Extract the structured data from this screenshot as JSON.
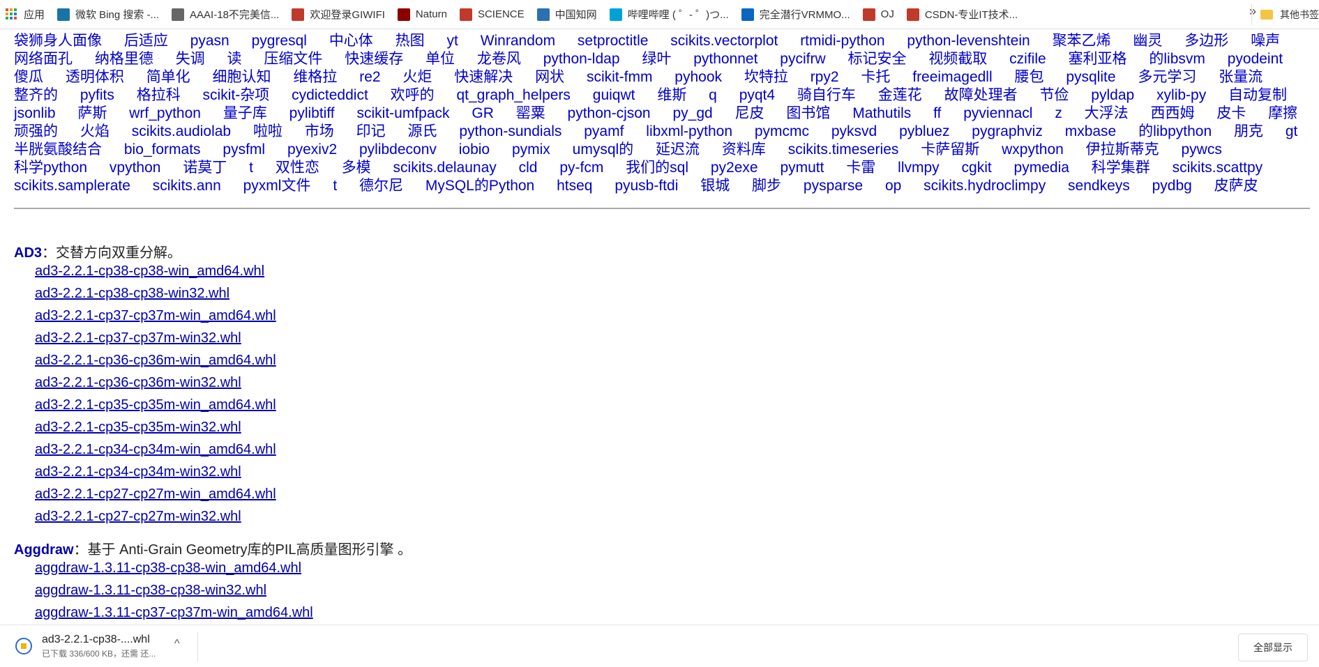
{
  "bookmarks": [
    {
      "label": "应用",
      "icon": "apps-grid-icon"
    },
    {
      "label": "微软 Bing 搜索 -...",
      "icon": "bing-icon"
    },
    {
      "label": "AAAI-18不完美信...",
      "icon": "globe-icon"
    },
    {
      "label": "欢迎登录GIWIFI",
      "icon": "giwifi-icon"
    },
    {
      "label": "Naturn",
      "icon": "nature-icon"
    },
    {
      "label": "SCIENCE",
      "icon": "science-icon"
    },
    {
      "label": "中国知网",
      "icon": "cnki-icon"
    },
    {
      "label": "哔哩哔哩 ( ゜- ゜)つ...",
      "icon": "bilibili-icon"
    },
    {
      "label": "完全潜行VRMMO...",
      "icon": "zhihu-icon"
    },
    {
      "label": "OJ",
      "icon": "oj-icon"
    },
    {
      "label": "CSDN-专业IT技术...",
      "icon": "csdn-icon"
    }
  ],
  "bookmarks_more": "»",
  "bookmarks_other": "其他书签",
  "package_cloud": [
    "袋狮身人面像",
    "后适应",
    "pyasn",
    "pygresql",
    "中心体",
    "热图",
    "yt",
    "Winrandom",
    "setproctitle",
    "scikits.vectorplot",
    "rtmidi-python",
    "python-levenshtein",
    "聚苯乙烯",
    "幽灵",
    "多边形",
    "噪声",
    "网络面孔",
    "纳格里德",
    "失调",
    "读",
    "压缩文件",
    "快速缓存",
    "单位",
    "龙卷风",
    "python-ldap",
    "绿叶",
    "pythonnet",
    "pycifrw",
    "标记安全",
    "视频截取",
    "czifile",
    "塞利亚格",
    "的libsvm",
    "pyodeint",
    "傻瓜",
    "透明体积",
    "简单化",
    "细胞认知",
    "维格拉",
    "re2",
    "火炬",
    "快速解决",
    "网状",
    "scikit-fmm",
    "pyhook",
    "坎特拉",
    "rpy2",
    "卡托",
    "freeimagedll",
    "腰包",
    "pysqlite",
    "多元学习",
    "张量流",
    "整齐的",
    "pyfits",
    "格拉科",
    "scikit-杂项",
    "cydicteddict",
    "欢呼的",
    "qt_graph_helpers",
    "guiqwt",
    "维斯",
    "q",
    "pyqt4",
    "骑自行车",
    "金莲花",
    "故障处理者",
    "节俭",
    "pyldap",
    "xylib-py",
    "自动复制",
    "jsonlib",
    "萨斯",
    "wrf_python",
    "量子库",
    "pylibtiff",
    "scikit-umfpack",
    "GR",
    "罂粟",
    "python-cjson",
    "py_gd",
    "尼皮",
    "图书馆",
    "Mathutils",
    "ff",
    "pyviennacl",
    "z",
    "大浮法",
    "西西姆",
    "皮卡",
    "摩擦",
    "顽强的",
    "火焰",
    "scikits.audiolab",
    "啦啦",
    "市场",
    "印记",
    "源氏",
    "python-sundials",
    "pyamf",
    "libxml-python",
    "pymcmc",
    "pyksvd",
    "pybluez",
    "pygraphviz",
    "mxbase",
    "的libpython",
    "朋克",
    "gt",
    "半胱氨酸结合",
    "bio_formats",
    "pysfml",
    "pyexiv2",
    "pylibdeconv",
    "iobio",
    "pymix",
    "umysql的",
    "延迟流",
    "资料库",
    "scikits.timeseries",
    "卡萨留斯",
    "wxpython",
    "伊拉斯蒂克",
    "pywcs",
    "科学python",
    "vpython",
    "诺莫丁",
    "t",
    "双性恋",
    "多模",
    "scikits.delaunay",
    "cld",
    "py-fcm",
    "我们的sql",
    "py2exe",
    "pymutt",
    "卡雷",
    "llvmpy",
    "cgkit",
    "pymedia",
    "科学集群",
    "scikits.scattpy",
    "scikits.samplerate",
    "scikits.ann",
    "pyxml文件",
    "t",
    "德尔尼",
    "MySQL的Python",
    "htseq",
    "pyusb-ftdi",
    "银城",
    "脚步",
    "pysparse",
    "op",
    "scikits.hydroclimpy",
    "sendkeys",
    "pydbg",
    "皮萨皮"
  ],
  "packages": [
    {
      "name": "AD3",
      "description": "：交替方向双重分解。",
      "files": [
        "ad3-2.2.1-cp38-cp38-win_amd64.whl",
        "ad3-2.2.1-cp38-cp38-win32.whl",
        "ad3-2.2.1-cp37-cp37m-win_amd64.whl",
        "ad3-2.2.1-cp37-cp37m-win32.whl",
        "ad3-2.2.1-cp36-cp36m-win_amd64.whl",
        "ad3-2.2.1-cp36-cp36m-win32.whl",
        "ad3-2.2.1-cp35-cp35m-win_amd64.whl",
        "ad3-2.2.1-cp35-cp35m-win32.whl",
        "ad3-2.2.1-cp34-cp34m-win_amd64.whl",
        "ad3-2.2.1-cp34-cp34m-win32.whl",
        "ad3-2.2.1-cp27-cp27m-win_amd64.whl",
        "ad3-2.2.1-cp27-cp27m-win32.whl"
      ]
    },
    {
      "name": "Aggdraw",
      "description": "：基于 Anti-Grain Geometry库的PIL高质量图形引擎 。",
      "files": [
        "aggdraw-1.3.11-cp38-cp38-win_amd64.whl",
        "aggdraw-1.3.11-cp38-cp38-win32.whl",
        "aggdraw-1.3.11-cp37-cp37m-win_amd64.whl"
      ]
    }
  ],
  "download": {
    "filename": "ad3-2.2.1-cp38-....whl",
    "status": "已下载 336/600 KB，还需 还...",
    "chevron": "^",
    "show_all": "全部显示"
  }
}
